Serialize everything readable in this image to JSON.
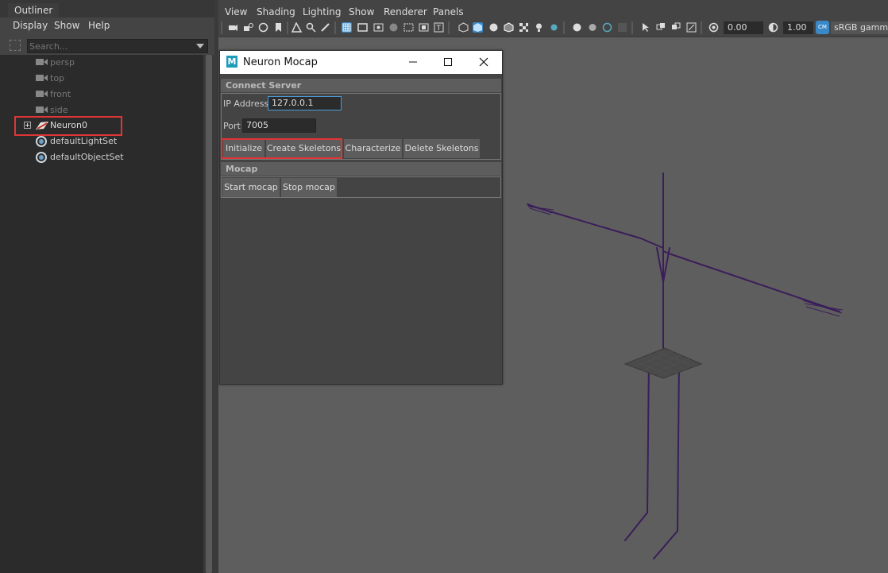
{
  "outliner": {
    "tab_label": "Outliner",
    "menu": [
      "Display",
      "Show",
      "Help"
    ],
    "search_placeholder": "Search...",
    "items": [
      {
        "label": "persp",
        "icon": "camera-icon"
      },
      {
        "label": "top",
        "icon": "camera-icon"
      },
      {
        "label": "front",
        "icon": "camera-icon"
      },
      {
        "label": "side",
        "icon": "camera-icon"
      },
      {
        "label": "Neuron0",
        "icon": "joint-icon",
        "expandable": true,
        "highlighted": true
      },
      {
        "label": "defaultLightSet",
        "icon": "set-icon"
      },
      {
        "label": "defaultObjectSet",
        "icon": "set-icon"
      }
    ]
  },
  "viewport": {
    "menu": [
      "View",
      "Shading",
      "Lighting",
      "Show",
      "Renderer",
      "Panels"
    ],
    "exposure_value": "0.00",
    "gamma_value": "1.00",
    "color_space_badge": "CM",
    "color_space_label": "sRGB gamma",
    "skeleton_color": "#3a1d5a",
    "background_color": "#5e5e5e"
  },
  "mocap_window": {
    "title": "Neuron Mocap",
    "logo_letter": "M",
    "connect_section": "Connect Server",
    "ip_label": "IP Address",
    "ip_value": "127.0.0.1",
    "port_label": "Port",
    "port_value": "7005",
    "buttons": {
      "initialize": "Initialize",
      "create_skeletons": "Create Skeletons",
      "characterize": "Characterize",
      "delete_skeletons": "Delete Skeletons"
    },
    "mocap_section": "Mocap",
    "start_mocap": "Start mocap",
    "stop_mocap": "Stop mocap"
  },
  "colors": {
    "highlight_red": "#e03535",
    "accent_blue": "#3a88c6"
  }
}
